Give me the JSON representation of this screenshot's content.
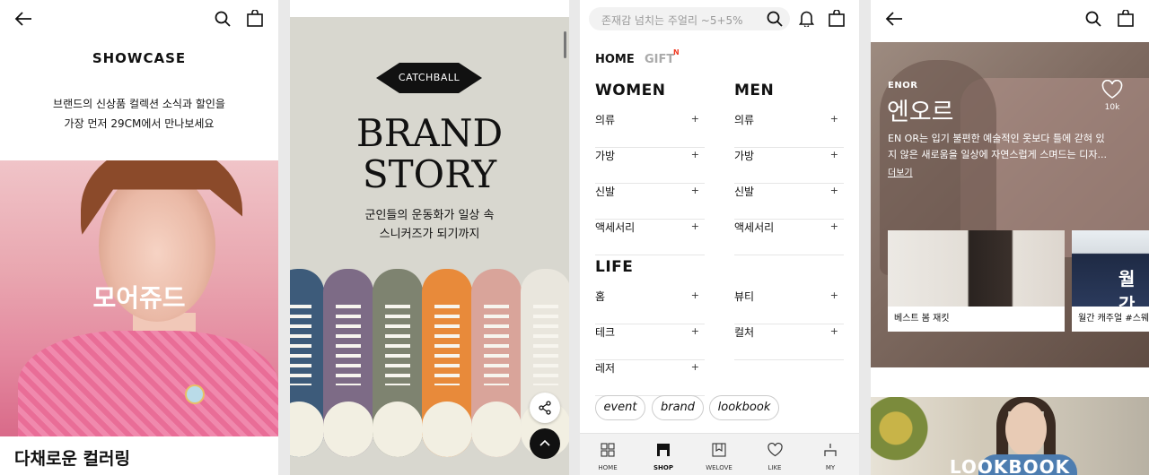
{
  "showcase": {
    "title": "SHOWCASE",
    "desc_lines": [
      "브랜드의 신상품 컬렉션 소식과 할인을",
      "가장 먼저 29CM에서 만나보세요"
    ],
    "hero_brand": "모어쥬드",
    "bottom_title": "다채로운 컬러링"
  },
  "brand_story": {
    "badge": "CATCHBALL",
    "heading_lines": [
      "BRAND",
      "STORY"
    ],
    "sub_lines": [
      "군인들의 운동화가 일상 속",
      "스니커즈가 되기까지"
    ],
    "shoe_colors": [
      "#3d5b7a",
      "#7d6b86",
      "#7e8370",
      "#e88a3a",
      "#d9a49a",
      "#e9e6dd"
    ]
  },
  "shop": {
    "search_placeholder": "존재감 넘치는 주얼리  ~5+5%",
    "tabs": [
      {
        "label": "HOME"
      },
      {
        "label": "GIFT"
      }
    ],
    "gift_new": "N",
    "women": {
      "title": "WOMEN",
      "items": [
        "의류",
        "가방",
        "신발",
        "액세서리"
      ]
    },
    "men": {
      "title": "MEN",
      "items": [
        "의류",
        "가방",
        "신발",
        "액세서리"
      ]
    },
    "life": {
      "title": "LIFE",
      "left": [
        "홈",
        "테크",
        "레저"
      ],
      "right": [
        "뷰티",
        "컬처"
      ]
    },
    "plus": "+",
    "chips": [
      "event",
      "brand",
      "lookbook"
    ],
    "nav": [
      {
        "label": "HOME",
        "icon": "grid-icon"
      },
      {
        "label": "SHOP",
        "icon": "store-icon",
        "active": true
      },
      {
        "label": "WELOVE",
        "icon": "bookmark-icon"
      },
      {
        "label": "LIKE",
        "icon": "heart-icon"
      },
      {
        "label": "MY",
        "icon": "user-icon"
      }
    ]
  },
  "brand_page": {
    "brand_en": "ENOR",
    "brand_ko": "엔오르",
    "desc_lines": [
      "EN OR는 입기 불편한 예술적인 옷보다 틀에 갇혀 있",
      "지 않은 새로움을 일상에 자연스럽게 스며드는 디자..."
    ],
    "more": "더보기",
    "like_count": "10k",
    "cards": [
      {
        "caption": "베스트 봄 재킷"
      },
      {
        "caption": "월간 캐주얼 #스웨",
        "overlay": "월간"
      }
    ],
    "lookbook": "LOOKBOOK"
  },
  "colors": {
    "accent_new": "#ef3b24",
    "text": "#111111"
  }
}
